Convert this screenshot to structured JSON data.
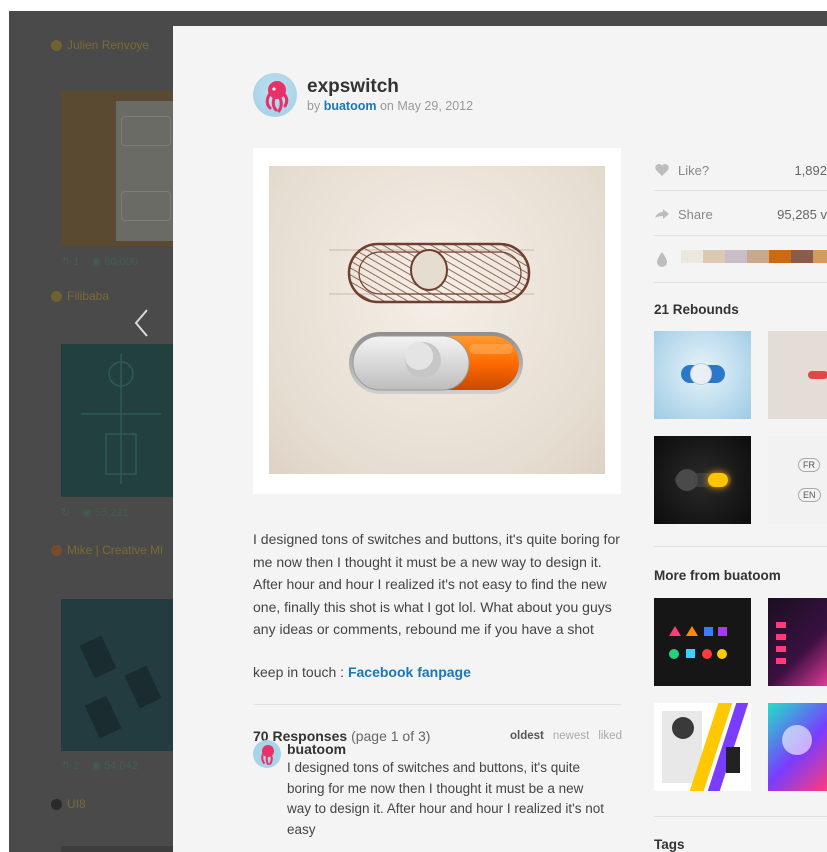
{
  "background": {
    "users": [
      "Julien Renvoye",
      "Filibaba",
      "Mike | Creative Mi",
      "UI8"
    ],
    "stats": [
      {
        "comments": "1",
        "views": "60,000"
      },
      {
        "comments": "",
        "views": "55,231"
      },
      {
        "comments": "2",
        "views": "54,042"
      }
    ]
  },
  "shot": {
    "title": "expswitch",
    "by_prefix": "by",
    "author": "buatoom",
    "date_prefix": "on",
    "date": "May 29, 2012"
  },
  "description": "I designed tons of switches and buttons, it's quite boring for me now then I thought it must be a new way to design it. After hour and hour I realized it's not easy to find the new one, finally this shot is what I got lol. What about you guys any ideas or comments, rebound me if you have a shot",
  "keep_in_touch": {
    "label": "keep in touch :",
    "link": "Facebook fanpage"
  },
  "responses": {
    "count_label": "70 Responses",
    "page_label": "(page 1 of 3)",
    "sort": [
      "oldest",
      "newest",
      "liked"
    ]
  },
  "comment": {
    "author": "buatoom",
    "text": "I designed tons of switches and buttons, it's quite boring for me now then I thought it must be a new way to design it. After hour and hour I realized it's not easy"
  },
  "sidebar": {
    "like_label": "Like?",
    "likes": "1,892",
    "share_label": "Share",
    "views": "95,285 v",
    "palette": [
      "#ece7df",
      "#ddc9b2",
      "#c9bec7",
      "#c9a98c",
      "#cc6a12",
      "#8a5c49",
      "#d59b5e"
    ],
    "rebounds_title": "21 Rebounds",
    "rebound_labels": [
      "FR",
      "EN"
    ],
    "more_title": "More from buatoom",
    "tags_title": "Tags"
  }
}
